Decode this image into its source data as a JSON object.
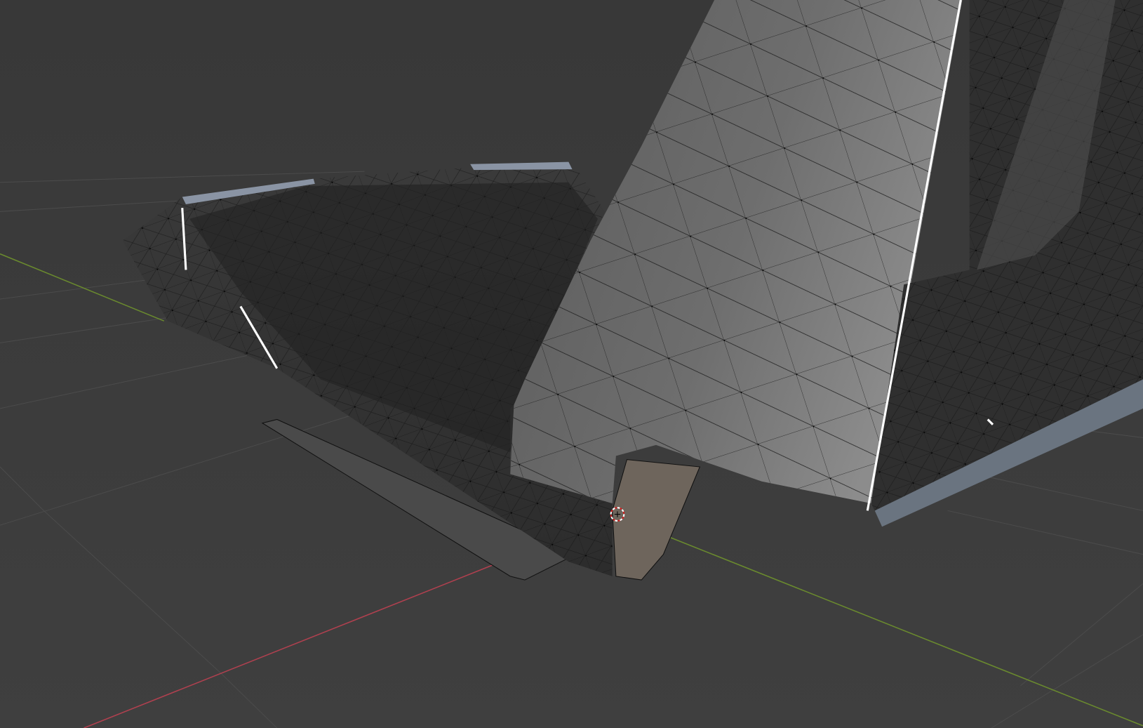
{
  "viewport": {
    "mode": "edit-mode-wireframe-overlay",
    "colors": {
      "background_top": "#3a3a3a",
      "background_bottom": "#3f3f3f",
      "grid": "#4a4a4a",
      "x_axis": "#b0404f",
      "y_axis": "#6a8a2e",
      "mesh_light": "#8a8a8a",
      "mesh_dark": "#232323",
      "vertex": "#000000",
      "selected_edge": "#ffffff"
    },
    "icons": [
      "3d-cursor-icon"
    ]
  }
}
